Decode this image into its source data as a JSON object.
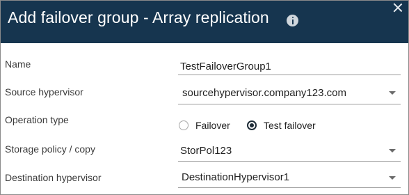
{
  "dialog": {
    "title": "Add failover group - Array replication",
    "info_icon": "info-icon",
    "close_icon": "close-icon"
  },
  "fields": {
    "name": {
      "label": "Name",
      "value": "TestFailoverGroup1"
    },
    "source_hypervisor": {
      "label": "Source hypervisor",
      "value": "sourcehypervisor.company123.com"
    },
    "operation_type": {
      "label": "Operation type",
      "options": [
        "Failover",
        "Test failover"
      ],
      "selected": "Test failover"
    },
    "storage_policy": {
      "label": "Storage policy / copy",
      "value": "StorPol123"
    },
    "destination_hypervisor": {
      "label": "Destination hypervisor",
      "value": "DestinationHypervisor1"
    }
  },
  "colors": {
    "header_bg": "#16354f",
    "header_text": "#ffffff",
    "radio_selected": "#1d2b36"
  }
}
